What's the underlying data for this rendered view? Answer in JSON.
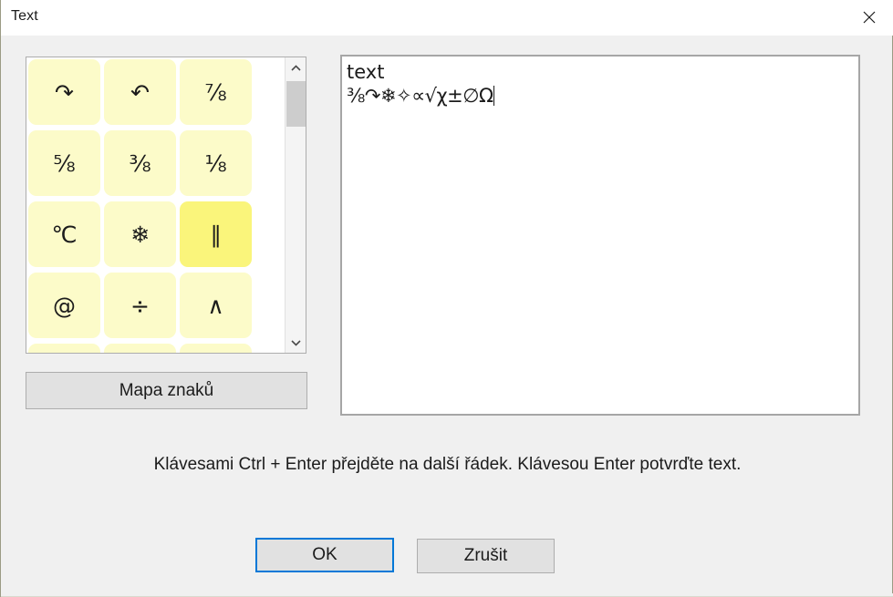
{
  "window": {
    "title": "Text",
    "close_icon": "close-icon"
  },
  "char_panel": {
    "rows": [
      [
        {
          "glyph": "↷",
          "name": "clockwise-arc-arrow",
          "selected": false
        },
        {
          "glyph": "↶",
          "name": "anticlockwise-arc-arrow",
          "selected": false
        },
        {
          "glyph": "⅞",
          "name": "seven-eighths",
          "selected": false
        }
      ],
      [
        {
          "glyph": "⅝",
          "name": "five-eighths",
          "selected": false
        },
        {
          "glyph": "⅜",
          "name": "three-eighths",
          "selected": false
        },
        {
          "glyph": "⅛",
          "name": "one-eighth",
          "selected": false
        }
      ],
      [
        {
          "glyph": "℃",
          "name": "degree-celsius",
          "selected": false
        },
        {
          "glyph": "❄",
          "name": "snowflake",
          "selected": false
        },
        {
          "glyph": "∥",
          "name": "parallel-to",
          "selected": true
        }
      ],
      [
        {
          "glyph": "@",
          "name": "at-sign",
          "selected": false
        },
        {
          "glyph": "÷",
          "name": "division-sign",
          "selected": false
        },
        {
          "glyph": "∧",
          "name": "logical-and",
          "selected": false
        }
      ]
    ],
    "scrollbar": {
      "up_arrow": "chevron-up-icon",
      "down_arrow": "chevron-down-icon"
    }
  },
  "charmap_button": {
    "label": "Mapa znaků"
  },
  "text_input": {
    "line1": "text",
    "line2": "⅜↷❄✧∝√χ±∅Ω"
  },
  "hint": {
    "text": "Klávesami Ctrl + Enter přejděte na další řádek. Klávesou Enter potvrďte text."
  },
  "footer": {
    "ok_label": "OK",
    "cancel_label": "Zrušit"
  },
  "colors": {
    "dialog_bg": "#f0f0f0",
    "cell_normal": "#fcfbc9",
    "cell_selected": "#faf57b",
    "focus_blue": "#0078d7",
    "button_bg": "#e1e1e1",
    "text": "#1b1b1b"
  }
}
